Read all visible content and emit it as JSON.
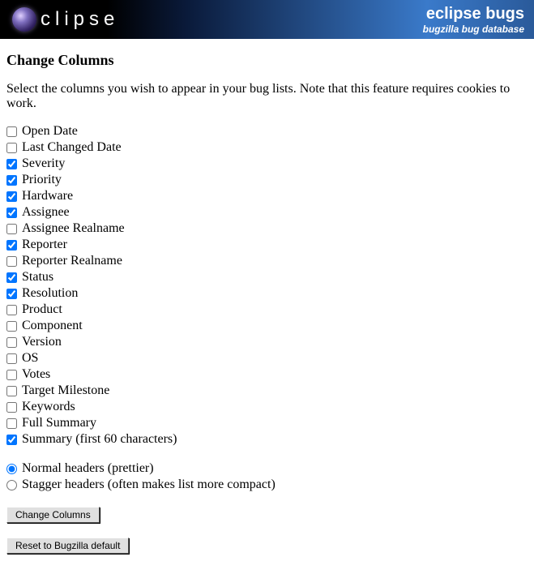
{
  "banner": {
    "logo_text": "clipse",
    "title": "eclipse bugs",
    "subtitle": "bugzilla bug database"
  },
  "page": {
    "heading": "Change Columns",
    "intro": "Select the columns you wish to appear in your bug lists. Note that this feature requires cookies to work."
  },
  "columns": [
    {
      "label": "Open Date",
      "checked": false
    },
    {
      "label": "Last Changed Date",
      "checked": false
    },
    {
      "label": "Severity",
      "checked": true
    },
    {
      "label": "Priority",
      "checked": true
    },
    {
      "label": "Hardware",
      "checked": true
    },
    {
      "label": "Assignee",
      "checked": true
    },
    {
      "label": "Assignee Realname",
      "checked": false
    },
    {
      "label": "Reporter",
      "checked": true
    },
    {
      "label": "Reporter Realname",
      "checked": false
    },
    {
      "label": "Status",
      "checked": true
    },
    {
      "label": "Resolution",
      "checked": true
    },
    {
      "label": "Product",
      "checked": false
    },
    {
      "label": "Component",
      "checked": false
    },
    {
      "label": "Version",
      "checked": false
    },
    {
      "label": "OS",
      "checked": false
    },
    {
      "label": "Votes",
      "checked": false
    },
    {
      "label": "Target Milestone",
      "checked": false
    },
    {
      "label": "Keywords",
      "checked": false
    },
    {
      "label": "Full Summary",
      "checked": false
    },
    {
      "label": "Summary (first 60 characters)",
      "checked": true
    }
  ],
  "header_style": {
    "options": [
      {
        "label": "Normal headers (prettier)",
        "checked": true
      },
      {
        "label": "Stagger headers (often makes list more compact)",
        "checked": false
      }
    ]
  },
  "buttons": {
    "submit": "Change Columns",
    "reset": "Reset to Bugzilla default"
  }
}
